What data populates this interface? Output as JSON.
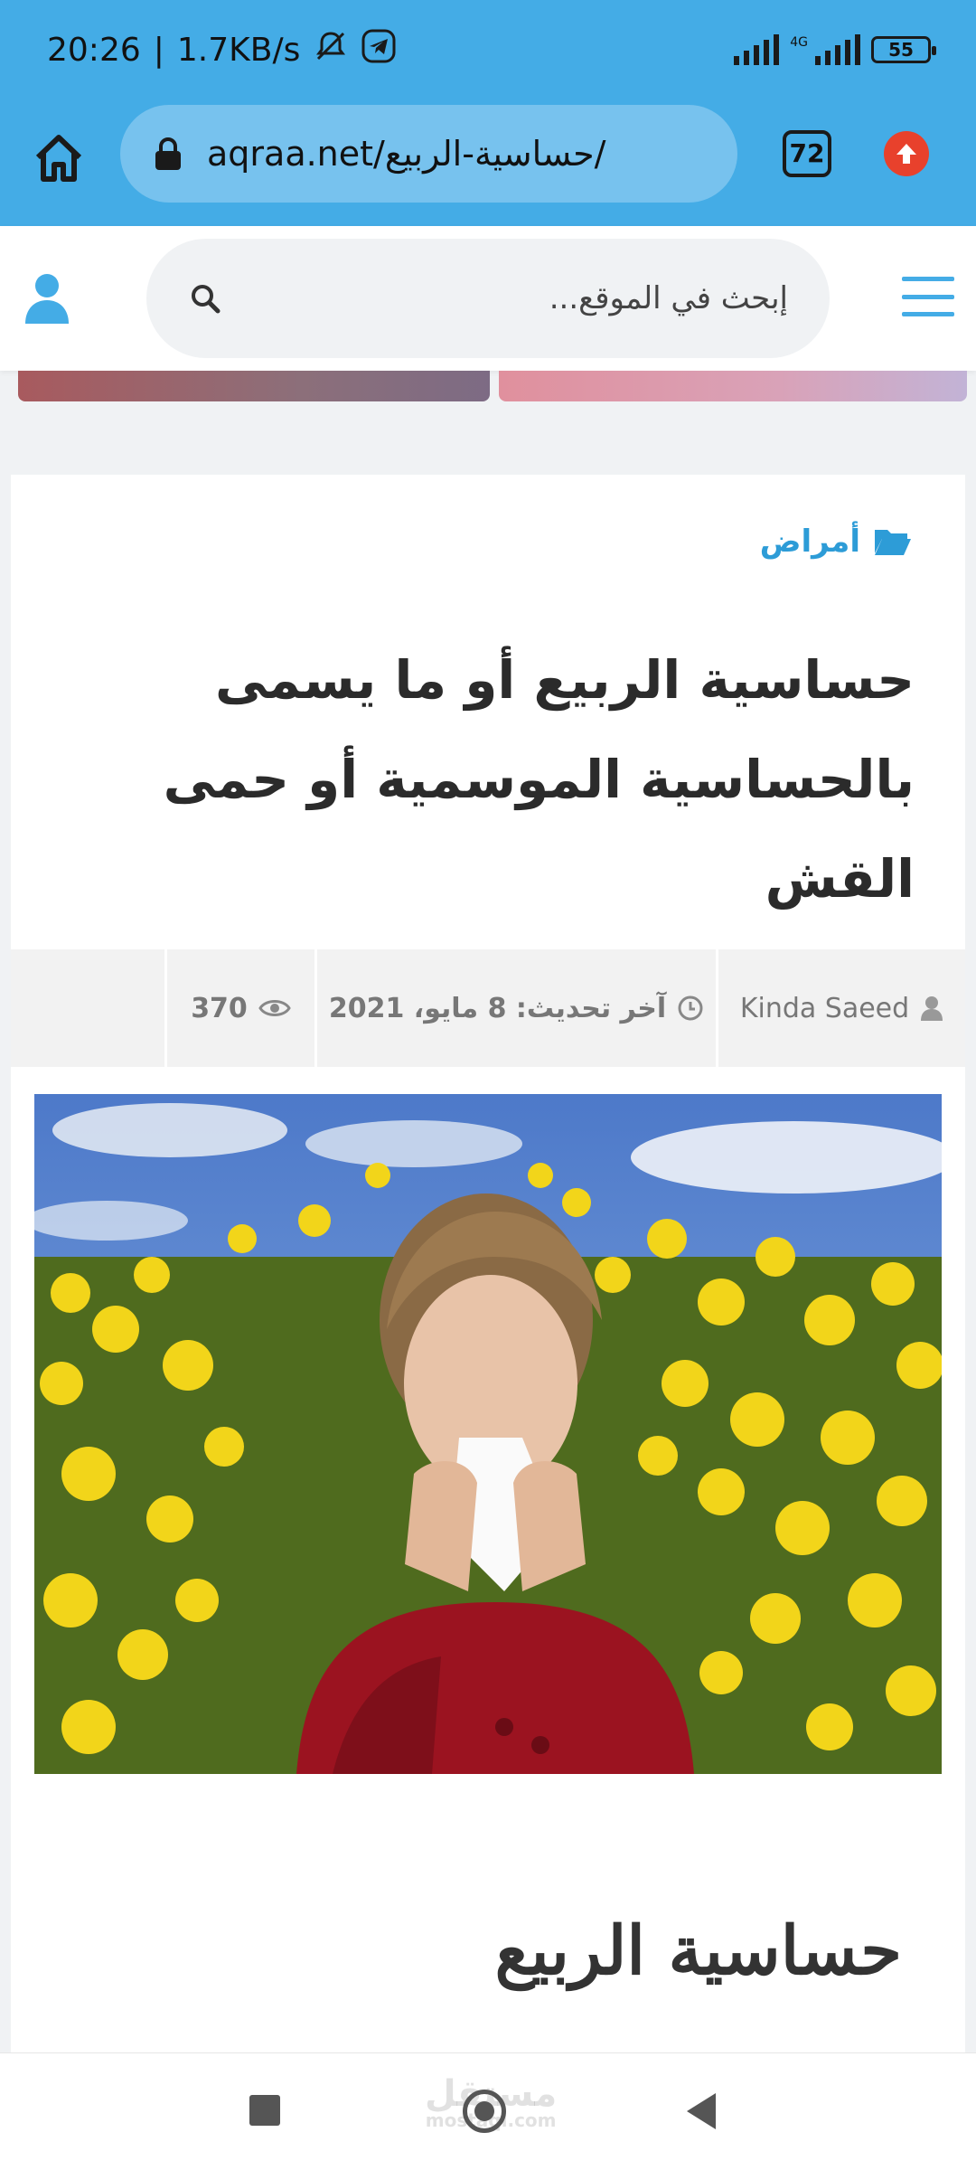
{
  "status_bar": {
    "time": "20:26",
    "speed": "1.7KB/s",
    "network": "4G",
    "battery": "55"
  },
  "browser": {
    "url": "aqraa.net/حساسية-الربيع/",
    "tab_count": "72"
  },
  "site_header": {
    "search_placeholder": "إبحث في الموقع..."
  },
  "article": {
    "category": "أمراض",
    "title": "حساسية الربيع أو ما يسمى بالحساسية الموسمية أو حمى القش",
    "author": "Kinda Saeed",
    "last_update": "آخر تحديث: 8 مايو، 2021",
    "views": "370",
    "subheading": "حساسية الربيع"
  },
  "watermark": {
    "text": "مستقل",
    "sub": "mostaql.com"
  },
  "colors": {
    "accent": "#44ace6",
    "category": "#2d9cd7",
    "update_button": "#e8412c"
  },
  "icons": {
    "category": "folder-open-icon",
    "author": "user-icon",
    "date": "clock-icon",
    "views": "eye-icon"
  }
}
